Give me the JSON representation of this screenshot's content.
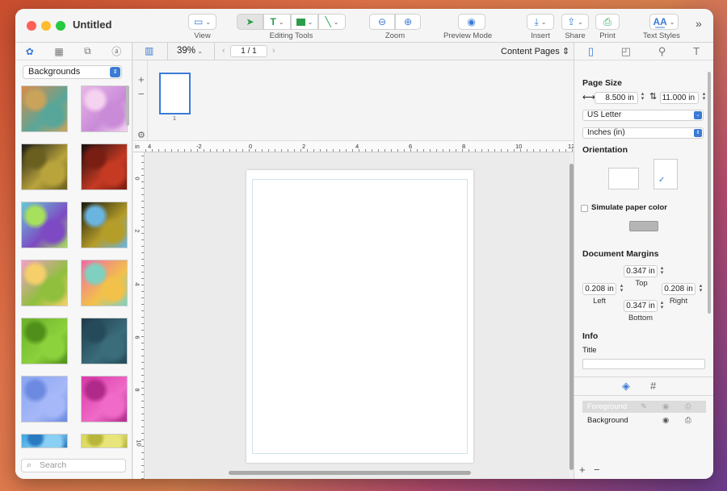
{
  "window": {
    "title": "Untitled"
  },
  "toolbar": {
    "view_label": "View",
    "editing_tools_label": "Editing Tools",
    "zoom_label": "Zoom",
    "preview_label": "Preview Mode",
    "insert_label": "Insert",
    "share_label": "Share",
    "print_label": "Print",
    "text_styles_label": "Text Styles",
    "more": "»"
  },
  "left_panel": {
    "category": "Backgrounds",
    "search_placeholder": "Search",
    "swatches": [
      {
        "colors": [
          "#d88a4a",
          "#58a69a",
          "#c9a35a"
        ]
      },
      {
        "colors": [
          "#e6b6e6",
          "#c98ad8",
          "#f4d2f0"
        ]
      },
      {
        "colors": [
          "#1a1a1a",
          "#b9a43c",
          "#6a5f1e"
        ]
      },
      {
        "colors": [
          "#1a0d0d",
          "#c63a23",
          "#7a1d12"
        ]
      },
      {
        "colors": [
          "#6ac7d8",
          "#7d4ac3",
          "#a6e05c"
        ]
      },
      {
        "colors": [
          "#1a1a0f",
          "#b59d2a",
          "#6ab4e0"
        ]
      },
      {
        "colors": [
          "#f2a0c8",
          "#8fbf3c",
          "#f5d06a"
        ]
      },
      {
        "colors": [
          "#f06aa8",
          "#f2c14a",
          "#7fd0c0"
        ]
      },
      {
        "colors": [
          "#6cb02a",
          "#8cd23c",
          "#4f8f1a"
        ]
      },
      {
        "colors": [
          "#1f3a4a",
          "#3a6c7a",
          "#254a5a"
        ]
      },
      {
        "colors": [
          "#8aa6f2",
          "#a6b8f8",
          "#6c8ae0"
        ]
      },
      {
        "colors": [
          "#d83aa8",
          "#f06ac8",
          "#b02a8a"
        ]
      },
      {
        "colors": [
          "#3aa6e0",
          "#8ad0f4",
          "#2a7ac0"
        ]
      },
      {
        "colors": [
          "#d8d65a",
          "#e8e67a",
          "#b8b63a"
        ]
      }
    ]
  },
  "document_nav": {
    "zoom": "39%",
    "page_indicator": "1 / 1",
    "content_pages": "Content Pages",
    "page_thumb_number": "1"
  },
  "rulers": {
    "unit": "in",
    "h_ticks": [
      "4",
      "-2",
      "0",
      "2",
      "4",
      "6",
      "8",
      "10",
      "12"
    ],
    "v_ticks": [
      "0",
      "2",
      "4",
      "6",
      "8",
      "10"
    ]
  },
  "inspector": {
    "page_size_heading": "Page Size",
    "width_value": "8.500 in",
    "height_value": "11.000 in",
    "paper_size": "US Letter",
    "units": "Inches (in)",
    "orientation_heading": "Orientation",
    "simulate_label": "Simulate paper color",
    "margins_heading": "Document Margins",
    "top_value": "0.347 in",
    "top_label": "Top",
    "left_value": "0.208 in",
    "left_label": "Left",
    "right_value": "0.208 in",
    "right_label": "Right",
    "bottom_value": "0.347 in",
    "bottom_label": "Bottom",
    "info_heading": "Info",
    "title_label": "Title",
    "layers": [
      "Foreground",
      "Background"
    ],
    "add": "+",
    "remove": "−"
  },
  "colors": {
    "accent": "#3a7bd5"
  }
}
